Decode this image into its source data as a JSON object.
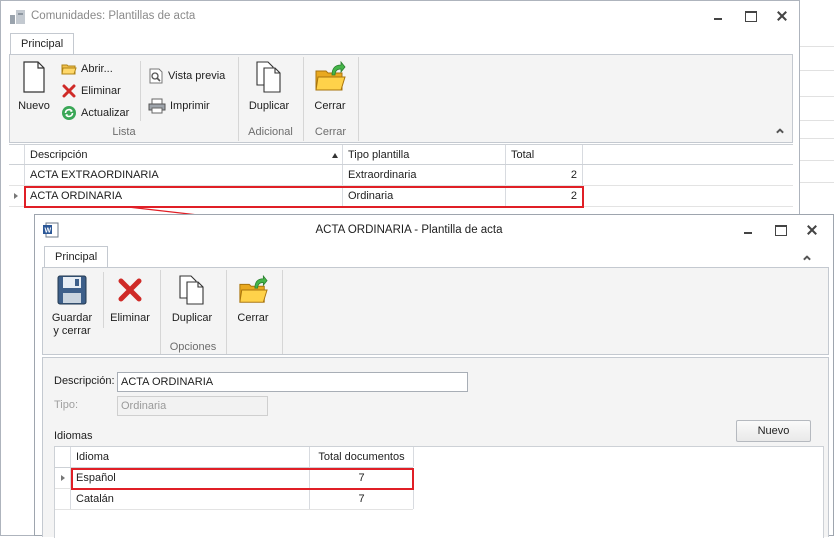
{
  "background": {
    "accent": "#e01f26"
  },
  "main_window": {
    "title": "Comunidades: Plantillas de acta",
    "tab": "Principal",
    "ribbon": {
      "new_label": "Nuevo",
      "open_label": "Abrir...",
      "delete_label": "Eliminar",
      "refresh_label": "Actualizar",
      "preview_label": "Vista previa",
      "print_label": "Imprimir",
      "duplicate_label": "Duplicar",
      "close_label": "Cerrar",
      "group_list": "Lista",
      "group_additional": "Adicional",
      "group_close": "Cerrar"
    },
    "grid": {
      "columns": [
        "Descripción",
        "Tipo plantilla",
        "Total"
      ],
      "rows": [
        {
          "descripcion": "ACTA EXTRAORDINARIA",
          "tipo": "Extraordinaria",
          "total": "2"
        },
        {
          "descripcion": "ACTA ORDINARIA",
          "tipo": "Ordinaria",
          "total": "2"
        }
      ]
    }
  },
  "detail_window": {
    "title": "ACTA ORDINARIA - Plantilla de acta",
    "tab": "Principal",
    "ribbon": {
      "save_close_label_1": "Guardar",
      "save_close_label_2": "y cerrar",
      "delete_label": "Eliminar",
      "duplicate_label": "Duplicar",
      "close_label": "Cerrar",
      "group_options": "Opciones"
    },
    "form": {
      "description_label": "Descripción:",
      "description_value": "ACTA ORDINARIA",
      "type_label": "Tipo:",
      "type_value": "Ordinaria",
      "languages_label": "Idiomas",
      "new_button": "Nuevo"
    },
    "grid": {
      "columns": [
        "Idioma",
        "Total documentos"
      ],
      "rows": [
        {
          "idioma": "Español",
          "total": "7"
        },
        {
          "idioma": "Catalán",
          "total": "7"
        }
      ]
    }
  }
}
